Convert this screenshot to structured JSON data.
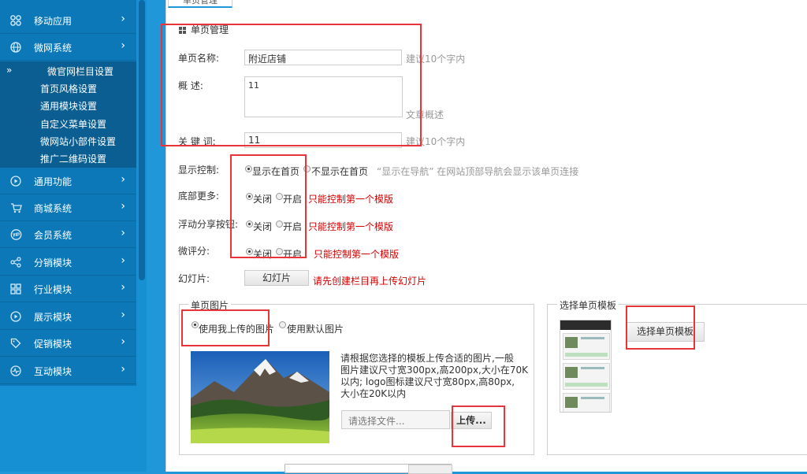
{
  "sidebar": {
    "items": [
      {
        "label": "移动应用",
        "icon": "grid-icon"
      },
      {
        "label": "微网系统",
        "icon": "globe-icon"
      },
      {
        "label": "通用功能",
        "icon": "play-circle-icon"
      },
      {
        "label": "商城系统",
        "icon": "cart-icon"
      },
      {
        "label": "会员系统",
        "icon": "vip-icon"
      },
      {
        "label": "分销模块",
        "icon": "share-icon"
      },
      {
        "label": "行业模块",
        "icon": "grid-icon"
      },
      {
        "label": "展示模块",
        "icon": "play-circle-icon"
      },
      {
        "label": "促销模块",
        "icon": "tag-icon"
      },
      {
        "label": "互动模块",
        "icon": "pulse-icon"
      }
    ],
    "submenu": [
      {
        "label": "微官网栏目设置"
      },
      {
        "label": "首页风格设置"
      },
      {
        "label": "通用模块设置"
      },
      {
        "label": "自定义菜单设置"
      },
      {
        "label": "微网站小部件设置"
      },
      {
        "label": "推广二维码设置"
      }
    ],
    "submenu_marker": "»",
    "arrow": "›"
  },
  "tab": {
    "label": "单页管理"
  },
  "section": {
    "title": "单页管理"
  },
  "form": {
    "name": {
      "label": "单页名称:",
      "value": "附近店铺",
      "hint": "建议10个字内"
    },
    "desc": {
      "label": "概    述:",
      "value": "11",
      "hint": "文章概述"
    },
    "keywords": {
      "label": "关 键 词:",
      "value": "11",
      "hint": "建议10个字内"
    },
    "display": {
      "label": "显示控制:",
      "opt_on": "显示在首页",
      "opt_off": "不显示在首页",
      "note": "“显示在导航” 在网站顶部导航会显示该单页连接"
    },
    "bottom_more": {
      "label": "底部更多:",
      "opt_close": "关闭",
      "opt_open": "开启",
      "note": "只能控制第一个模版"
    },
    "share_button": {
      "label": "浮动分享按钮:",
      "opt_close": "关闭",
      "opt_open": "开启",
      "note": "只能控制第一个模版"
    },
    "micro_comment": {
      "label": "微评分:",
      "opt_close": "关闭",
      "opt_open": "开启",
      "note": "只能控制第一个模版"
    },
    "slides": {
      "label": "幻灯片:",
      "button": "幻灯片",
      "note": "请先创建栏目再上传幻灯片"
    }
  },
  "image_box": {
    "legend": "单页图片",
    "opt_mine": "使用我上传的图片",
    "opt_default": "使用默认图片",
    "instructions": [
      "请根据您选择的模板上传合适的图片,一般",
      "图片建议尺寸宽300px,高200px,大小在70K",
      "以内; logo图标建议尺寸宽80px,高80px,",
      "大小在20K以内"
    ],
    "file_placeholder": "请选择文件...",
    "upload_button": "上传..."
  },
  "template_box": {
    "legend": "选择单页模板",
    "button": "选择单页模板"
  },
  "colors": {
    "sidebar_bg": "#0d78b8",
    "submenu_bg": "#0b5e91",
    "accent": "#1f97d8",
    "annotation_red": "#e8353a",
    "note_red": "#d40000"
  }
}
